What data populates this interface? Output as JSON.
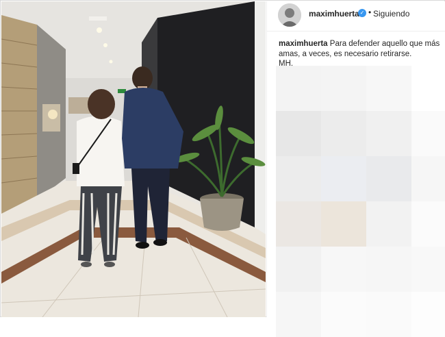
{
  "post": {
    "username": "maximhuerta",
    "verified": true,
    "separator": "•",
    "follow_status": "Siguiendo",
    "caption_user": "maximhuerta",
    "caption_text": "Para defender aquello que más amas, a veces, es necesario retirarse.",
    "caption_signature": "MH."
  },
  "icons": {
    "verified": "verified-badge-icon",
    "avatar": "profile-avatar"
  },
  "colors": {
    "verified": "#3897f0",
    "text": "#262626",
    "border": "#efefef"
  },
  "mosaic_colors": [
    [
      "#f3f3f3",
      "#f4f4f4",
      "#f7f7f7",
      "#ffffff"
    ],
    [
      "#e7e7e7",
      "#ececec",
      "#f0f0f0",
      "#fafafa"
    ],
    [
      "#ececec",
      "#ebedf1",
      "#e9eaec",
      "#f6f6f6"
    ],
    [
      "#ebe7e3",
      "#ece5db",
      "#f2f2f2",
      "#fbfbfb"
    ],
    [
      "#f1f1f1",
      "#f7f7f7",
      "#f6f6f6",
      "#f8f8f8"
    ],
    [
      "#f6f6f6",
      "#fbfbfb",
      "#fafafa",
      "#fdfdfd"
    ]
  ]
}
